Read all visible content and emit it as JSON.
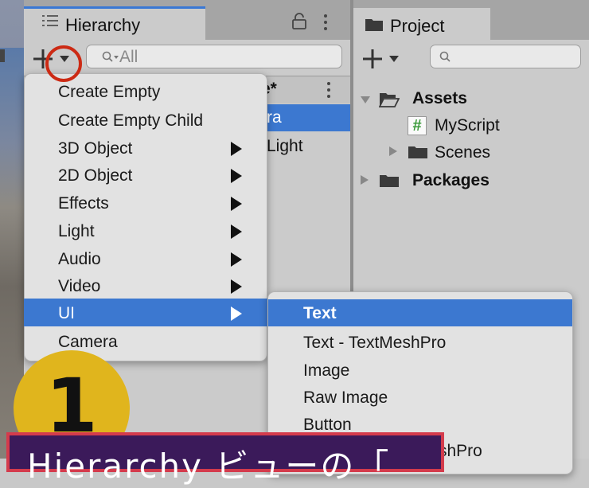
{
  "hierarchy": {
    "tab_icon": "list-icon",
    "tab_label": "Hierarchy",
    "lock_icon": "lock-icon",
    "more_icon": "vertical-dots-icon",
    "add_icon": "plus-icon",
    "dropdown_icon": "chevron-down-icon",
    "search_placeholder": "All",
    "scene_row_partial": "e*",
    "row_items": [
      "ra",
      "Light"
    ]
  },
  "project": {
    "tab_icon": "folder-icon",
    "tab_label": "Project",
    "add_icon": "plus-icon",
    "tree": {
      "assets_label": "Assets",
      "myscript_icon": "hash-icon",
      "myscript_label": "MyScript",
      "scenes_label": "Scenes",
      "packages_label": "Packages"
    }
  },
  "menu": {
    "items": [
      {
        "label": "Create Empty",
        "has_submenu": false
      },
      {
        "label": "Create Empty Child",
        "has_submenu": false
      },
      {
        "label": "3D Object",
        "has_submenu": true
      },
      {
        "label": "2D Object",
        "has_submenu": true
      },
      {
        "label": "Effects",
        "has_submenu": true
      },
      {
        "label": "Light",
        "has_submenu": true
      },
      {
        "label": "Audio",
        "has_submenu": true
      },
      {
        "label": "Video",
        "has_submenu": true
      },
      {
        "label": "UI",
        "has_submenu": true,
        "selected": true
      },
      {
        "label": "Camera",
        "has_submenu": false
      }
    ]
  },
  "submenu": {
    "items": [
      {
        "label": "Text",
        "selected": true
      },
      {
        "label": "Text - TextMeshPro"
      },
      {
        "label": "Image"
      },
      {
        "label": "Raw Image"
      },
      {
        "label": "Button"
      },
      {
        "label": "shPro"
      }
    ]
  },
  "annotation": {
    "step_number": "1",
    "caption": "Hierarchy ビューの「",
    "colors": {
      "circle": "#cc2a14",
      "badge": "#e0b51d",
      "caption_bg": "#3b1a5a",
      "caption_border": "#d43b4c"
    }
  },
  "colors": {
    "selection": "#3c78d0",
    "panel": "#cbcbcb"
  }
}
